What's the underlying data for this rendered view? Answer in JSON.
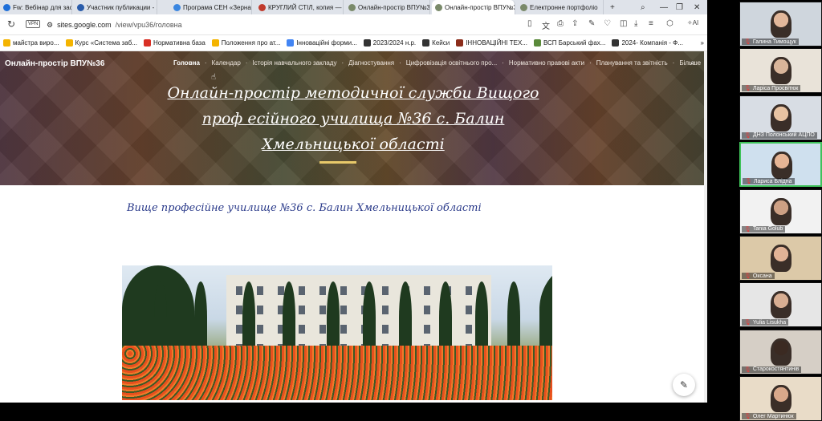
{
  "browser": {
    "tabs": [
      {
        "label": "Fw: Вебінар для заступни",
        "color": "#1e6fd9"
      },
      {
        "label": "Участник публикации - 2",
        "color": "#2a5caa"
      },
      {
        "label": "Програма СЕН «Зерна»",
        "color": "#3a86e0"
      },
      {
        "label": "КРУГЛИЙ СТІЛ, копия —",
        "color": "#c0392b"
      },
      {
        "label": "Онлайн-простір ВПУ№3",
        "color": "#7a8a6a"
      },
      {
        "label": "Онлайн-простір ВПУ№36",
        "color": "#7a8a6a"
      },
      {
        "label": "Електронне портфоліо",
        "color": "#7a8a6a"
      }
    ],
    "address": {
      "host": "sites.google.com",
      "path": "/view/vpu36/головна",
      "vpn_label": "VPN"
    },
    "bookmarks": [
      {
        "label": "майстра виро...",
        "color": "#f4b400"
      },
      {
        "label": "Курс «Система заб...",
        "color": "#f4b400"
      },
      {
        "label": "Нормативна база",
        "color": "#d93025"
      },
      {
        "label": "Положення про ат...",
        "color": "#f4b400"
      },
      {
        "label": "Інноваційні форми...",
        "color": "#4285f4"
      },
      {
        "label": "2023/2024 н.р.",
        "color": "#333333"
      },
      {
        "label": "Кейси",
        "color": "#333333"
      },
      {
        "label": "ІННОВАЦІЙНІ ТЕХ...",
        "color": "#8b2c1a"
      },
      {
        "label": "ВСП Барський фах...",
        "color": "#5a8a3a"
      },
      {
        "label": "2024- Компанія - Ф...",
        "color": "#333333"
      }
    ],
    "bookmarks_more": "»",
    "ai_label": "AI"
  },
  "site": {
    "title": "Онлайн-простір ВПУ№36",
    "nav": [
      "Головна",
      "Календар",
      "Історія навчального закладу",
      "Діагностування",
      "Цифровізація освітнього про...",
      "Нормативно правові акти",
      "Планування та звітність",
      "Більше"
    ],
    "hero_heading": [
      " Онлайн-простір методичної служби Вищого",
      "проф есійного училища №36 с. Балин",
      "Хмельницької області"
    ],
    "subtitle": "Вище професійне училище №36 с. Балин Хмельницької області"
  },
  "participants": [
    {
      "name": "Галина Тимощук",
      "bg": "#cfd6dd",
      "skin": "#e2b79a"
    },
    {
      "name": "Ларіса Просвітюк",
      "bg": "#e9e3d9",
      "skin": "#d9b59a"
    },
    {
      "name": "ДНЗ Полонський АЦПО",
      "bg": "#d8dde4",
      "skin": "#e8c3a2"
    },
    {
      "name": "Лариса Бліднa",
      "bg": "#cfe0ee",
      "skin": "#e6b595"
    },
    {
      "name": "Tania Golub",
      "bg": "#f2f2f2",
      "skin": "#cda084"
    },
    {
      "name": "Оксана",
      "bg": "#dcc9a8",
      "skin": "#e2b396"
    },
    {
      "name": "Yulia Lisukha",
      "bg": "#e6e6e6",
      "skin": "#d8ae92"
    },
    {
      "name": "Старокостянтинів",
      "bg": "#d6cfc6",
      "skin": "#3b2a22"
    },
    {
      "name": "Олег Мартинюк",
      "bg": "#e9dcc8",
      "skin": "#d9a88a"
    }
  ]
}
